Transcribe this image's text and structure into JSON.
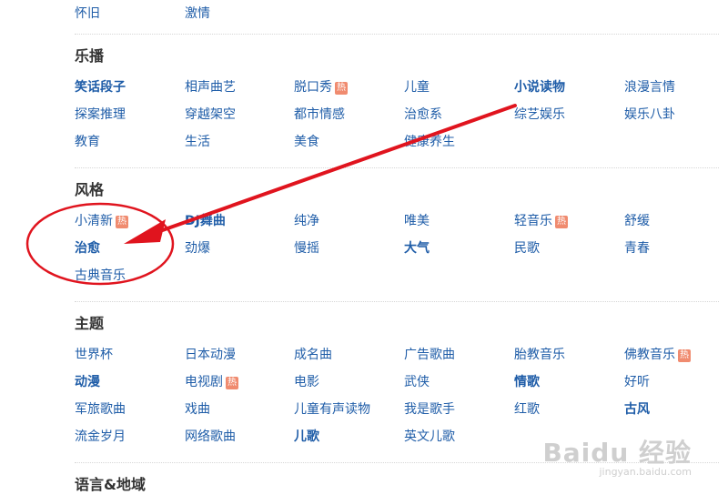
{
  "top_row": [
    "怀旧",
    "激情"
  ],
  "sections": [
    {
      "title": "乐播",
      "items": [
        {
          "label": "笑话段子",
          "bold": true,
          "hot": false
        },
        {
          "label": "相声曲艺",
          "bold": false,
          "hot": false
        },
        {
          "label": "脱口秀",
          "bold": false,
          "hot": true
        },
        {
          "label": "儿童",
          "bold": false,
          "hot": false
        },
        {
          "label": "小说读物",
          "bold": true,
          "hot": false
        },
        {
          "label": "浪漫言情",
          "bold": false,
          "hot": false
        },
        {
          "label": "探案推理",
          "bold": false,
          "hot": false
        },
        {
          "label": "穿越架空",
          "bold": false,
          "hot": false
        },
        {
          "label": "都市情感",
          "bold": false,
          "hot": false
        },
        {
          "label": "治愈系",
          "bold": false,
          "hot": false
        },
        {
          "label": "综艺娱乐",
          "bold": false,
          "hot": false
        },
        {
          "label": "娱乐八卦",
          "bold": false,
          "hot": false
        },
        {
          "label": "教育",
          "bold": false,
          "hot": false
        },
        {
          "label": "生活",
          "bold": false,
          "hot": false
        },
        {
          "label": "美食",
          "bold": false,
          "hot": false
        },
        {
          "label": "健康养生",
          "bold": false,
          "hot": false
        }
      ]
    },
    {
      "title": "风格",
      "items": [
        {
          "label": "小清新",
          "bold": false,
          "hot": true
        },
        {
          "label": "DJ舞曲",
          "bold": true,
          "hot": false
        },
        {
          "label": "纯净",
          "bold": false,
          "hot": false
        },
        {
          "label": "唯美",
          "bold": false,
          "hot": false
        },
        {
          "label": "轻音乐",
          "bold": false,
          "hot": true
        },
        {
          "label": "舒缓",
          "bold": false,
          "hot": false
        },
        {
          "label": "治愈",
          "bold": true,
          "hot": false
        },
        {
          "label": "劲爆",
          "bold": false,
          "hot": false
        },
        {
          "label": "慢摇",
          "bold": false,
          "hot": false
        },
        {
          "label": "大气",
          "bold": true,
          "hot": false
        },
        {
          "label": "民歌",
          "bold": false,
          "hot": false
        },
        {
          "label": "青春",
          "bold": false,
          "hot": false
        },
        {
          "label": "古典音乐",
          "bold": false,
          "hot": false
        }
      ]
    },
    {
      "title": "主题",
      "items": [
        {
          "label": "世界杯",
          "bold": false,
          "hot": false
        },
        {
          "label": "日本动漫",
          "bold": false,
          "hot": false
        },
        {
          "label": "成名曲",
          "bold": false,
          "hot": false
        },
        {
          "label": "广告歌曲",
          "bold": false,
          "hot": false
        },
        {
          "label": "胎教音乐",
          "bold": false,
          "hot": false
        },
        {
          "label": "佛教音乐",
          "bold": false,
          "hot": true
        },
        {
          "label": "动漫",
          "bold": true,
          "hot": false
        },
        {
          "label": "电视剧",
          "bold": false,
          "hot": true
        },
        {
          "label": "电影",
          "bold": false,
          "hot": false
        },
        {
          "label": "武侠",
          "bold": false,
          "hot": false
        },
        {
          "label": "情歌",
          "bold": true,
          "hot": false
        },
        {
          "label": "好听",
          "bold": false,
          "hot": false
        },
        {
          "label": "军旅歌曲",
          "bold": false,
          "hot": false
        },
        {
          "label": "戏曲",
          "bold": false,
          "hot": false
        },
        {
          "label": "儿童有声读物",
          "bold": false,
          "hot": false
        },
        {
          "label": "我是歌手",
          "bold": false,
          "hot": false
        },
        {
          "label": "红歌",
          "bold": false,
          "hot": false
        },
        {
          "label": "古风",
          "bold": true,
          "hot": false
        },
        {
          "label": "流金岁月",
          "bold": false,
          "hot": false
        },
        {
          "label": "网络歌曲",
          "bold": false,
          "hot": false
        },
        {
          "label": "儿歌",
          "bold": true,
          "hot": false
        },
        {
          "label": "英文儿歌",
          "bold": false,
          "hot": false
        }
      ]
    },
    {
      "title": "语言&地域",
      "items": []
    }
  ],
  "hot_badge": "热",
  "watermark": {
    "brand": "Baidu 经验",
    "sub": "jingyan.baidu.com"
  },
  "colors": {
    "link": "#1f5da8",
    "title": "#333333",
    "hot": "#f08b6f",
    "annotation": "#e0141e"
  }
}
